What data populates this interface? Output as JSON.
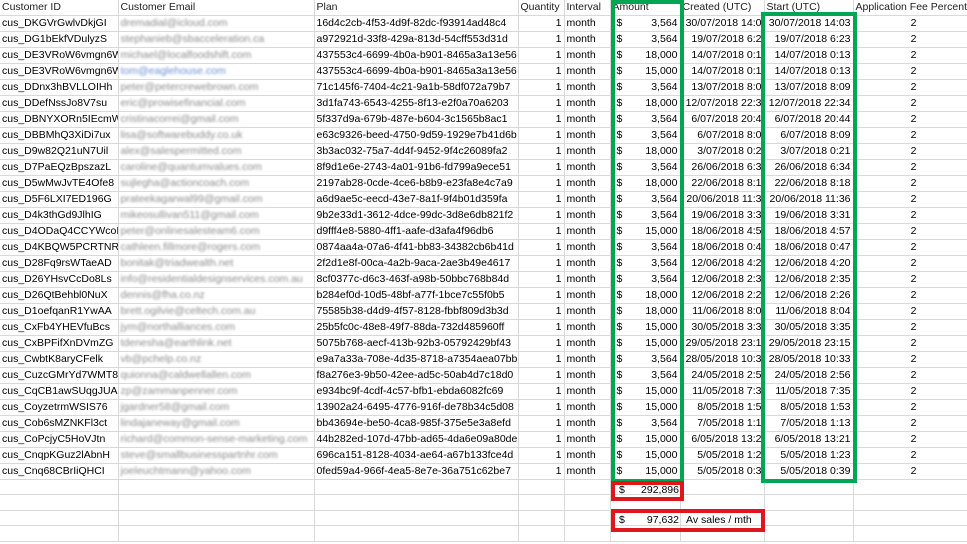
{
  "headers": [
    "Customer ID",
    "Customer Email",
    "Plan",
    "Quantity",
    "Interval",
    "Amount",
    "Created (UTC)",
    "Start (UTC)",
    "Application Fee Percent"
  ],
  "rows": [
    [
      "cus_DKGVrGwlvDkjGI",
      "dremadial@icloud.com",
      "16d4c2cb-4f53-4d9f-82dc-f93914ad48c4",
      "1",
      "month",
      "3,564",
      "30/07/2018 14:0",
      "30/07/2018 14:03",
      "2"
    ],
    [
      "cus_DG1bEkfVDulyzS",
      "stephanieb@sbacceleration.ca",
      "a972921d-33f8-429a-813d-54cff553d31d",
      "1",
      "month",
      "3,564",
      "19/07/2018 6:2",
      "19/07/2018 6:23",
      "2"
    ],
    [
      "cus_DE3VRoW6vmgn6W",
      "michael@localfoodshift.com",
      "437553c4-6699-4b0a-b901-8465a3a13e56",
      "1",
      "month",
      "18,000",
      "14/07/2018 0:1",
      "14/07/2018 0:13",
      "2"
    ],
    [
      "cus_DE3VRoW6vmgn6W",
      "tom@eaglehouse.com",
      "437553c4-6699-4b0a-b901-8465a3a13e56",
      "1",
      "month",
      "15,000",
      "14/07/2018 0:1",
      "14/07/2018 0:13",
      "2"
    ],
    [
      "cus_DDnx3hBVLLOIHh",
      "peter@petercrewebrown.com",
      "71c145f6-7404-4c21-9a1b-58df072a79b7",
      "1",
      "month",
      "3,564",
      "13/07/2018 8:0",
      "13/07/2018 8:09",
      "2"
    ],
    [
      "cus_DDefNssJo8V7su",
      "eric@prowisefinancial.com",
      "3d1fa743-6543-4255-8f13-e2f0a70a6203",
      "1",
      "month",
      "18,000",
      "12/07/2018 22:3",
      "12/07/2018 22:34",
      "2"
    ],
    [
      "cus_DBNYXORn5IEcmW",
      "cristinacorrei@gmail.com",
      "5f337d9a-679b-487e-b604-3c1565b8ac1",
      "1",
      "month",
      "3,564",
      "6/07/2018 20:4",
      "6/07/2018 20:44",
      "2"
    ],
    [
      "cus_DBBMhQ3XiDi7ux",
      "lisa@softwarebuddy.co.uk",
      "e63c9326-beed-4750-9d59-1929e7b41d6b",
      "1",
      "month",
      "3,564",
      "6/07/2018 8:0",
      "6/07/2018 8:09",
      "2"
    ],
    [
      "cus_D9w82Q21uN7Uil",
      "alex@salespermitted.com",
      "3b3ac032-75a7-4d4f-9452-9f4c26089fa2",
      "1",
      "month",
      "18,000",
      "3/07/2018 0:2",
      "3/07/2018 0:21",
      "2"
    ],
    [
      "cus_D7PaEQzBpszazL",
      "caroline@quantumvalues.com",
      "8f9d1e6e-2743-4a01-91b6-fd799a9ece51",
      "1",
      "month",
      "3,564",
      "26/06/2018 6:3",
      "26/06/2018 6:34",
      "2"
    ],
    [
      "cus_D5wMwJvTE4Ofe8",
      "sujlegha@actioncoach.com",
      "2197ab28-0cde-4ce6-b8b9-e23fa8e4c7a9",
      "1",
      "month",
      "18,000",
      "22/06/2018 8:1",
      "22/06/2018 8:18",
      "2"
    ],
    [
      "cus_D5F6LXI7ED196G",
      "prateekagarwal99@gmail.com",
      "a6d9ae5c-eecd-43e7-8a1f-9f4b01d359fa",
      "1",
      "month",
      "3,564",
      "20/06/2018 11:3",
      "20/06/2018 11:36",
      "2"
    ],
    [
      "cus_D4k3thGd9JlhIG",
      "mikeosullivan511@gmail.com",
      "9b2e33d1-3612-4dce-99dc-3d8e6db821f2",
      "1",
      "month",
      "3,564",
      "19/06/2018 3:3",
      "19/06/2018 3:31",
      "2"
    ],
    [
      "cus_D4ODaQ4CCYWcoI",
      "peter@onlinesalesteam6.com",
      "d9fff4e8-5880-4ff1-aafe-d3afa4f96db6",
      "1",
      "month",
      "15,000",
      "18/06/2018 4:5",
      "18/06/2018 4:57",
      "2"
    ],
    [
      "cus_D4KBQW5PCRTNRe",
      "cathleen.fillmore@rogers.com",
      "0874aa4a-07a6-4f41-bb83-34382cb6b41d",
      "1",
      "month",
      "3,564",
      "18/06/2018 0:4",
      "18/06/2018 0:47",
      "2"
    ],
    [
      "cus_D28Fq9rsWTaeAD",
      "bonitak@triadwealth.net",
      "2f2d1e8f-00ca-4a2b-9aca-2ae3b49e4617",
      "1",
      "month",
      "3,564",
      "12/06/2018 4:2",
      "12/06/2018 4:20",
      "2"
    ],
    [
      "cus_D26YHsvCcDo8Ls",
      "info@residentialdesignservices.com.au",
      "8cf0377c-d6c3-463f-a98b-50bbc768b84d",
      "1",
      "month",
      "3,564",
      "12/06/2018 2:3",
      "12/06/2018 2:35",
      "2"
    ],
    [
      "cus_D26QtBehbl0NuX",
      "dennis@fha.co.nz",
      "b284ef0d-10d5-48bf-a77f-1bce7c55f0b5",
      "1",
      "month",
      "18,000",
      "12/06/2018 2:2",
      "12/06/2018 2:26",
      "2"
    ],
    [
      "cus_D1oefqanR1YwAA",
      "brett.ogilvie@celtech.com.au",
      "75585b38-d4d9-4f57-8128-fbbf809d3b3d",
      "1",
      "month",
      "18,000",
      "11/06/2018 8:0",
      "11/06/2018 8:04",
      "2"
    ],
    [
      "cus_CxFb4YHEVfuBcs",
      "jym@northalliances.com",
      "25b5fc0c-48e8-49f7-88da-732d485960ff",
      "1",
      "month",
      "15,000",
      "30/05/2018 3:3",
      "30/05/2018 3:35",
      "2"
    ],
    [
      "cus_CxBPFifXnDVmZG",
      "tdenesha@earthlink.net",
      "5075b768-aecf-413b-92b3-05792429bf43",
      "1",
      "month",
      "15,000",
      "29/05/2018 23:1",
      "29/05/2018 23:15",
      "2"
    ],
    [
      "cus_CwbtK8aryCFelk",
      "vb@pchelp.co.nz",
      "e9a7a33a-708e-4d35-8718-a7354aea07bb",
      "1",
      "month",
      "3,564",
      "28/05/2018 10:3",
      "28/05/2018 10:33",
      "2"
    ],
    [
      "cus_CuzcGMrYd7WMT8",
      "quionna@caldwellallen.com",
      "f8a276e3-9b50-42ee-ad5c-50ab4d7c18d0",
      "1",
      "month",
      "3,564",
      "24/05/2018 2:5",
      "24/05/2018 2:56",
      "2"
    ],
    [
      "cus_CqCB1awSUqgJUA",
      "zp@zammanpenner.com",
      "e934bc9f-4cdf-4c57-bfb1-ebda6082fc69",
      "1",
      "month",
      "15,000",
      "11/05/2018 7:3",
      "11/05/2018 7:35",
      "2"
    ],
    [
      "cus_CoyzetrmWSIS76",
      "jgardner58@gmail.com",
      "13902a24-6495-4776-916f-de78b34c5d08",
      "1",
      "month",
      "15,000",
      "8/05/2018 1:5",
      "8/05/2018 1:53",
      "2"
    ],
    [
      "cus_Cob6sMZNKFl3ct",
      "lindajaneway@gmail.com",
      "bb43694e-be50-4ca8-985f-375e5e3a8efd",
      "1",
      "month",
      "3,564",
      "7/05/2018 1:1",
      "7/05/2018 1:13",
      "2"
    ],
    [
      "cus_CoPcjyC5HoVJtn",
      "richard@common-sense-marketing.com",
      "44b282ed-107d-47bb-ad65-4da6e09a80de",
      "1",
      "month",
      "15,000",
      "6/05/2018 13:2",
      "6/05/2018 13:21",
      "2"
    ],
    [
      "cus_CnqpKGuz2lAbnH",
      "steve@smallbusinesspartnhr.com",
      "696ca151-8128-4034-ae64-a67b133fce4d",
      "1",
      "month",
      "15,000",
      "5/05/2018 1:2",
      "5/05/2018 1:23",
      "2"
    ],
    [
      "cus_Cnq68CBrIiQHCI",
      "joeleuchtmann@yahoo.com",
      "0fed59a4-966f-4ea5-8e7e-36a751c62be7",
      "1",
      "month",
      "15,000",
      "5/05/2018 0:3",
      "5/05/2018 0:39",
      "2"
    ]
  ],
  "currency_symbol": "$",
  "total": {
    "symbol": "$",
    "value": "292,896"
  },
  "average": {
    "symbol": "$",
    "value": "97,632",
    "label": "Av sales / mth"
  },
  "colors": {
    "highlight_green": "#00a651",
    "highlight_red": "#e0161c"
  },
  "link_email_row_index": 3
}
